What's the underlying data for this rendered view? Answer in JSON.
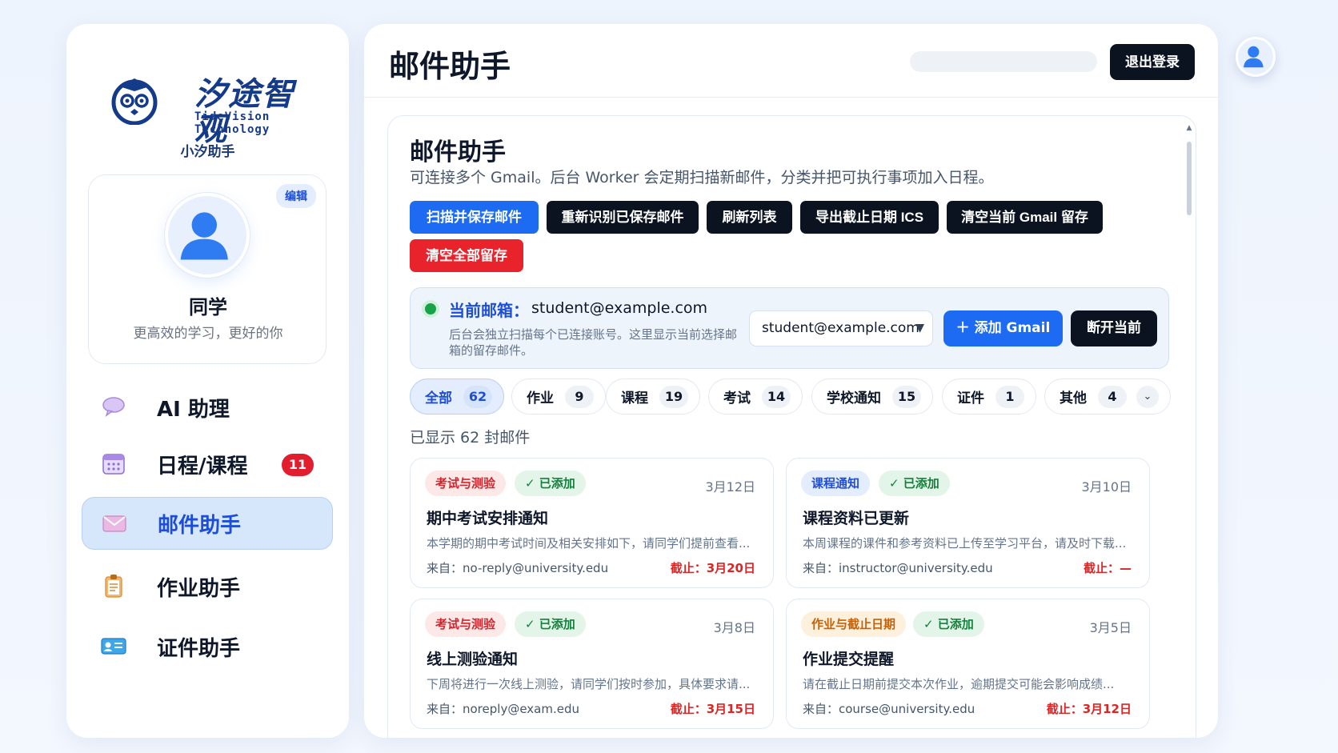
{
  "brand": {
    "name_cn": "汐途智观",
    "name_en": "TideVision Technology",
    "assistant": "小汐助手"
  },
  "profile": {
    "edit": "编辑",
    "name": "同学",
    "slogan": "更高效的学习，更好的你"
  },
  "nav": {
    "ai": "AI 助理",
    "schedule": "日程/课程",
    "schedule_badge": "11",
    "mail": "邮件助手",
    "homework": "作业助手",
    "id": "证件助手"
  },
  "header": {
    "title": "邮件助手",
    "logout": "退出登录"
  },
  "section": {
    "title": "邮件助手",
    "desc": "可连接多个 Gmail。后台 Worker 会定期扫描新邮件，分类并把可执行事项加入日程。"
  },
  "actions": {
    "scan": "扫描并保存邮件",
    "rescan": "重新识别已保存邮件",
    "refresh": "刷新列表",
    "export": "导出截止日期 ICS",
    "clear_current": "清空当前 Gmail 留存",
    "clear_all": "清空全部留存"
  },
  "account": {
    "label": "当前邮箱：",
    "email": "student@example.com",
    "hint": "后台会独立扫描每个已连接账号。这里显示当前选择邮箱的留存邮件。",
    "selected": "student@example.com",
    "add": "＋ 添加 Gmail",
    "disconnect": "断开当前"
  },
  "filters": [
    {
      "label": "全部",
      "count": "62"
    },
    {
      "label": "作业",
      "count": "9"
    },
    {
      "label": "课程",
      "count": "19"
    },
    {
      "label": "考试",
      "count": "14"
    },
    {
      "label": "学校通知",
      "count": "15"
    },
    {
      "label": "证件",
      "count": "1"
    },
    {
      "label": "其他",
      "count": "4"
    }
  ],
  "shown": "已显示 62 封邮件",
  "mails": [
    {
      "tag": "考试与测验",
      "added": "✓ 已添加",
      "date": "3月12日",
      "title": "期中考试安排通知",
      "snippet": "本学期的期中考试时间及相关安排如下，请同学们提前查看...",
      "from": "来自：no-reply@university.edu",
      "deadline": "截止：3月20日"
    },
    {
      "tag": "课程通知",
      "added": "✓ 已添加",
      "date": "3月10日",
      "title": "课程资料已更新",
      "snippet": "本周课程的课件和参考资料已上传至学习平台，请及时下载...",
      "from": "来自：instructor@university.edu",
      "deadline": "截止：—"
    },
    {
      "tag": "考试与测验",
      "added": "✓ 已添加",
      "date": "3月8日",
      "title": "线上测验通知",
      "snippet": "下周将进行一次线上测验，请同学们按时参加，具体要求请...",
      "from": "来自：noreply@exam.edu",
      "deadline": "截止：3月15日"
    },
    {
      "tag": "作业与截止日期",
      "added": "✓ 已添加",
      "date": "3月5日",
      "title": "作业提交提醒",
      "snippet": "请在截止日期前提交本次作业，逾期提交可能会影响成绩...",
      "from": "来自：course@university.edu",
      "deadline": "截止：3月12日"
    }
  ]
}
